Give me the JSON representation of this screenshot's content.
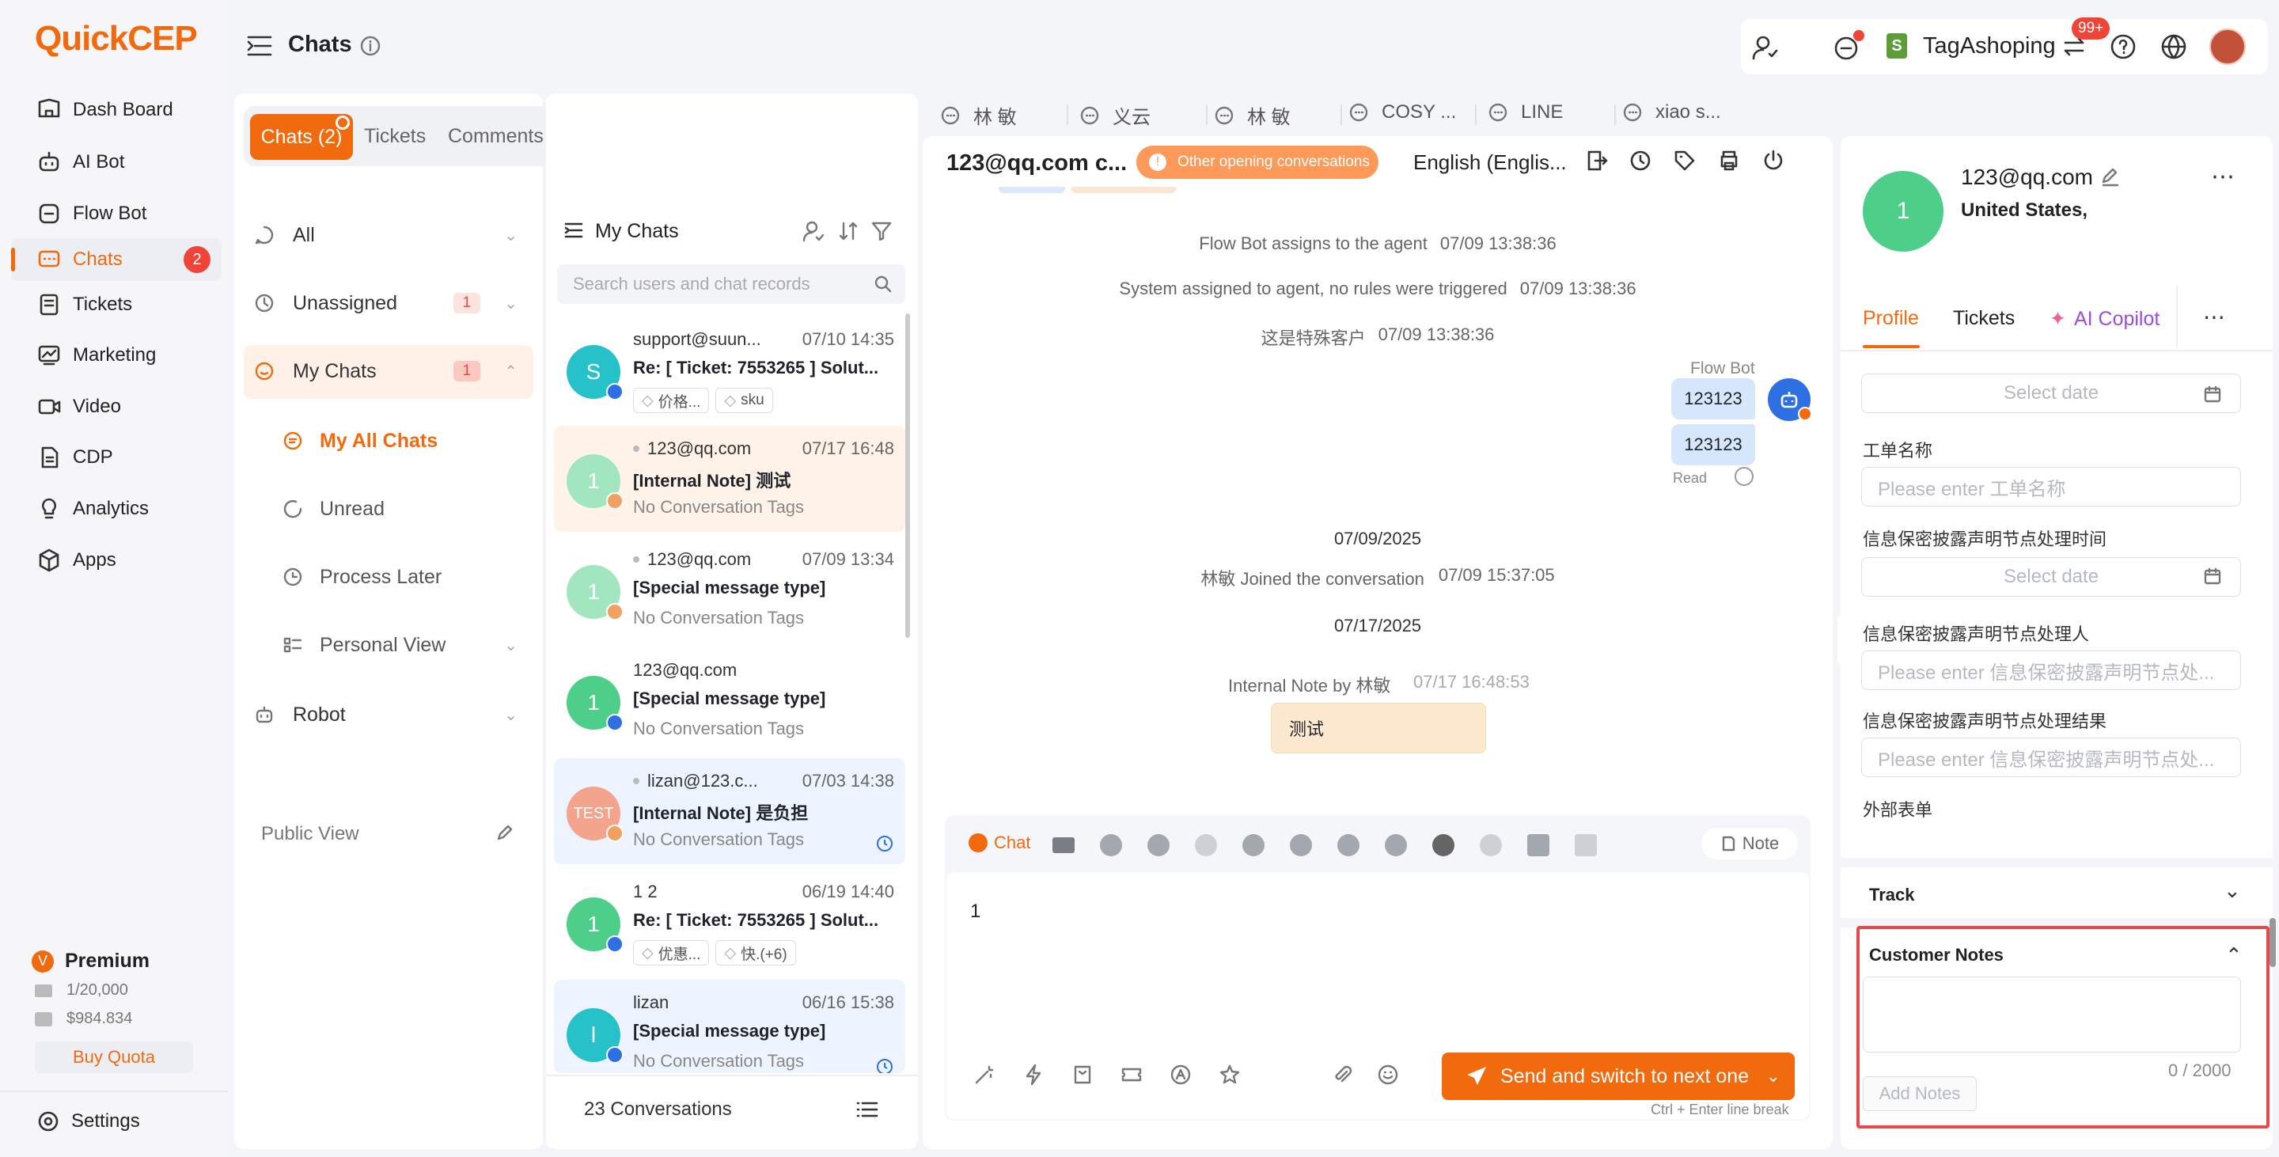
{
  "app": {
    "logo": "QuickCEP"
  },
  "sidebar": {
    "items": [
      {
        "label": "Dash Board",
        "icon": "dashboard-icon"
      },
      {
        "label": "AI Bot",
        "icon": "robot-icon"
      },
      {
        "label": "Flow Bot",
        "icon": "flow-bot-icon"
      },
      {
        "label": "Chats",
        "icon": "chat-icon",
        "badge": "2"
      },
      {
        "label": "Tickets",
        "icon": "ticket-icon"
      },
      {
        "label": "Marketing",
        "icon": "marketing-icon"
      },
      {
        "label": "Video",
        "icon": "video-icon"
      },
      {
        "label": "CDP",
        "icon": "cdp-icon"
      },
      {
        "label": "Analytics",
        "icon": "bulb-icon"
      },
      {
        "label": "Apps",
        "icon": "apps-icon"
      }
    ],
    "plan": {
      "name": "Premium",
      "quota": "1/20,000",
      "balance": "$984.834",
      "buy_label": "Buy Quota"
    },
    "settings_label": "Settings"
  },
  "header": {
    "title": "Chats",
    "store_name": "TagAshoping",
    "notif_badge": "99+"
  },
  "filter": {
    "tabs": [
      {
        "label": "Chats (2)"
      },
      {
        "label": "Tickets"
      },
      {
        "label": "Comments"
      }
    ],
    "items": [
      {
        "label": "All"
      },
      {
        "label": "Unassigned",
        "count": "1"
      },
      {
        "label": "My Chats",
        "count": "1"
      }
    ],
    "sub_items": [
      {
        "label": "My All Chats"
      },
      {
        "label": "Unread"
      },
      {
        "label": "Process Later"
      },
      {
        "label": "Personal View"
      }
    ],
    "robot_label": "Robot",
    "public_view_label": "Public View"
  },
  "chat_list": {
    "title": "My Chats",
    "search_placeholder": "Search users and chat records",
    "footer": "23 Conversations",
    "rows": [
      {
        "avatar": "S",
        "name": "support@suun...",
        "time": "07/10 14:35",
        "msg": "Re: [ Ticket: 7553265 ] Solut...",
        "tags": [
          "价格...",
          "sku"
        ]
      },
      {
        "avatar": "1",
        "name": "123@qq.com",
        "time": "07/17 16:48",
        "msg": "[Internal Note] 测试",
        "sub": "No Conversation Tags"
      },
      {
        "avatar": "1",
        "name": "123@qq.com",
        "time": "07/09 13:34",
        "msg": "[Special message type]",
        "sub": "No Conversation Tags"
      },
      {
        "avatar": "1",
        "name": "123@qq.com",
        "time": "",
        "msg": "[Special message type]",
        "sub": "No Conversation Tags"
      },
      {
        "avatar": "TEST",
        "name": "lizan@123.c...",
        "time": "07/03 14:38",
        "msg": "[Internal Note] 是负担",
        "sub": "No Conversation Tags"
      },
      {
        "avatar": "1",
        "name": "1 2",
        "time": "06/19 14:40",
        "msg": "Re: [ Ticket: 7553265 ] Solut...",
        "tags": [
          "优惠...",
          "快.(+6)"
        ]
      },
      {
        "avatar": "l",
        "name": "lizan",
        "time": "06/16 15:38",
        "msg": "[Special message type]",
        "sub": "No Conversation Tags"
      }
    ]
  },
  "conversation": {
    "tabs": [
      {
        "label": "林 敏"
      },
      {
        "label": "义云"
      },
      {
        "label": "林 敏"
      },
      {
        "label": "COSY ..."
      },
      {
        "label": "LINE"
      },
      {
        "label": "xiao s..."
      }
    ],
    "title": "123@qq.com c...",
    "opening_notice": "Other opening conversations",
    "language": "English (Englis...",
    "messages": [
      {
        "text": "Flow Bot assigns to the agent",
        "time": "07/09 13:38:36"
      },
      {
        "text": "System assigned to agent, no rules were triggered",
        "time": "07/09 13:38:36"
      },
      {
        "text": "这是特殊客户",
        "time": "07/09 13:38:36"
      }
    ],
    "bot_name": "Flow Bot",
    "bot_bubbles": [
      "123123",
      "123123"
    ],
    "read_label": "Read",
    "date1": "07/09/2025",
    "joined_text": "林敏 Joined the conversation",
    "joined_time": "07/09 15:37:05",
    "date2": "07/17/2025",
    "note_by": "Internal Note by 林敏",
    "note_time": "07/17 16:48:53",
    "note_text": "测试",
    "composer": {
      "chat_tab": "Chat",
      "note_tab": "Note",
      "text": "1",
      "send_label": "Send and switch to next one",
      "hint": "Ctrl + Enter line break"
    }
  },
  "profile": {
    "avatar": "1",
    "email": "123@qq.com",
    "location": "United States,",
    "tabs": [
      {
        "label": "Profile"
      },
      {
        "label": "Tickets"
      },
      {
        "label": "AI Copilot"
      }
    ],
    "fields": [
      {
        "label": "",
        "placeholder": "Select date",
        "type": "date"
      },
      {
        "label": "工单名称",
        "placeholder": "Please enter 工单名称"
      },
      {
        "label": "信息保密披露声明节点处理时间",
        "placeholder": "Select date",
        "type": "date"
      },
      {
        "label": "信息保密披露声明节点处理人",
        "placeholder": "Please enter 信息保密披露声明节点处..."
      },
      {
        "label": "信息保密披露声明节点处理结果",
        "placeholder": "Please enter 信息保密披露声明节点处..."
      },
      {
        "label": "外部表单",
        "placeholder": ""
      }
    ],
    "track_label": "Track",
    "notes": {
      "title": "Customer Notes",
      "counter": "0 / 2000",
      "add_label": "Add Notes"
    }
  },
  "colors": {
    "brand": "#f26a0e",
    "highlight": "#e5484d"
  }
}
